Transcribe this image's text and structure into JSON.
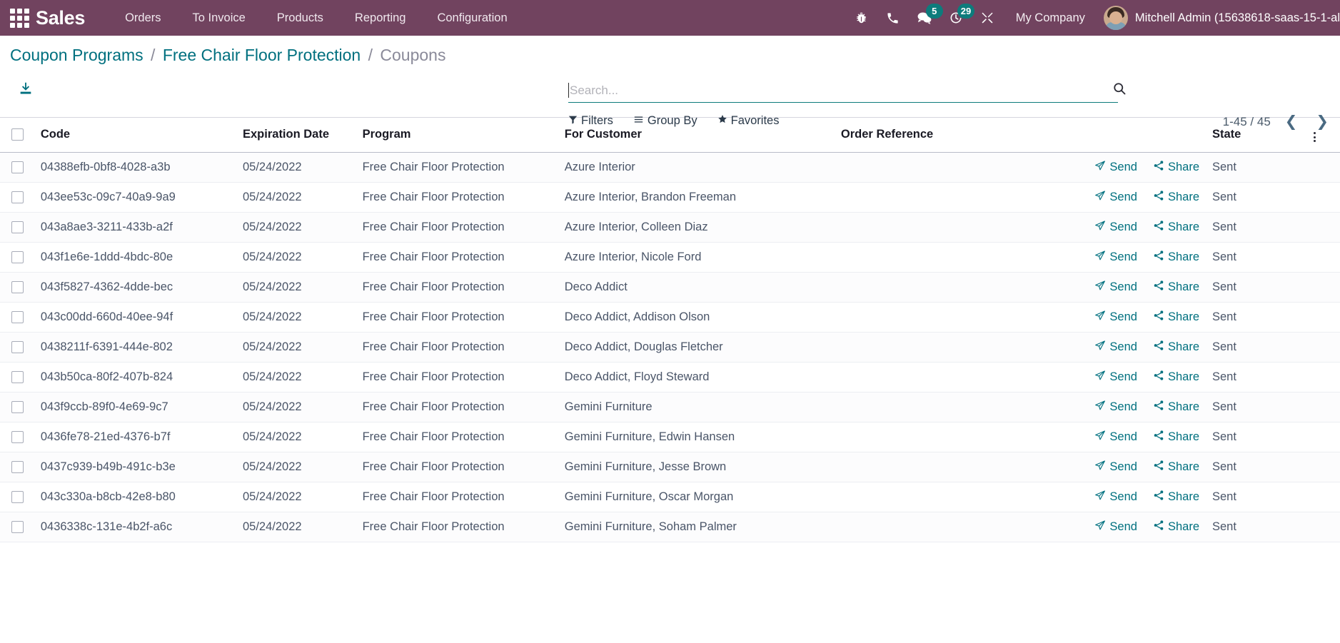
{
  "navbar": {
    "apps_icon": "apps-grid-icon",
    "brand": "Sales",
    "menu": [
      {
        "label": "Orders"
      },
      {
        "label": "To Invoice"
      },
      {
        "label": "Products"
      },
      {
        "label": "Reporting"
      },
      {
        "label": "Configuration"
      }
    ],
    "icons": [
      {
        "name": "bug-icon",
        "badge": ""
      },
      {
        "name": "phone-icon",
        "badge": ""
      },
      {
        "name": "messages-icon",
        "badge": "5"
      },
      {
        "name": "activities-clock-icon",
        "badge": "29"
      },
      {
        "name": "developer-tools-icon",
        "badge": ""
      }
    ],
    "company": "My Company",
    "user": "Mitchell Admin (15638618-saas-15-1-al",
    "bg_color": "#71435f",
    "badge_color": "#0d7c7c"
  },
  "breadcrumb": {
    "items": [
      {
        "label": "Coupon Programs",
        "current": false
      },
      {
        "label": "Free Chair Floor Protection",
        "current": false
      },
      {
        "label": "Coupons",
        "current": true
      }
    ],
    "separator": "/",
    "link_color": "#00707f"
  },
  "actions": {
    "download_icon": "download-icon"
  },
  "search": {
    "placeholder": "Search...",
    "value": "",
    "magnifier_icon": "search-icon",
    "underline_color": "#0d7c7c"
  },
  "filterbar": [
    {
      "label": "Filters",
      "icon": "filter-funnel-icon"
    },
    {
      "label": "Group By",
      "icon": "group-by-lines-icon"
    },
    {
      "label": "Favorites",
      "icon": "star-icon"
    }
  ],
  "pager": {
    "range": "1-45 / 45",
    "prev_icon": "chevron-left-icon",
    "next_icon": "chevron-right-icon"
  },
  "table": {
    "columns": [
      "Code",
      "Expiration Date",
      "Program",
      "For Customer",
      "Order Reference",
      "State"
    ],
    "row_action_labels": {
      "send": "Send",
      "share": "Share"
    },
    "row_action_icons": {
      "send": "paper-plane-icon",
      "share": "share-alt-icon"
    },
    "optional_columns_icon": "vertical-dots-icon",
    "rows": [
      {
        "code": "04388efb-0bf8-4028-a3b",
        "expiration": "05/24/2022",
        "program": "Free Chair Floor Protection",
        "customer": "Azure Interior",
        "order": "",
        "state": "Sent"
      },
      {
        "code": "043ee53c-09c7-40a9-9a9",
        "expiration": "05/24/2022",
        "program": "Free Chair Floor Protection",
        "customer": "Azure Interior, Brandon Freeman",
        "order": "",
        "state": "Sent"
      },
      {
        "code": "043a8ae3-3211-433b-a2f",
        "expiration": "05/24/2022",
        "program": "Free Chair Floor Protection",
        "customer": "Azure Interior, Colleen Diaz",
        "order": "",
        "state": "Sent"
      },
      {
        "code": "043f1e6e-1ddd-4bdc-80e",
        "expiration": "05/24/2022",
        "program": "Free Chair Floor Protection",
        "customer": "Azure Interior, Nicole Ford",
        "order": "",
        "state": "Sent"
      },
      {
        "code": "043f5827-4362-4dde-bec",
        "expiration": "05/24/2022",
        "program": "Free Chair Floor Protection",
        "customer": "Deco Addict",
        "order": "",
        "state": "Sent"
      },
      {
        "code": "043c00dd-660d-40ee-94f",
        "expiration": "05/24/2022",
        "program": "Free Chair Floor Protection",
        "customer": "Deco Addict, Addison Olson",
        "order": "",
        "state": "Sent"
      },
      {
        "code": "0438211f-6391-444e-802",
        "expiration": "05/24/2022",
        "program": "Free Chair Floor Protection",
        "customer": "Deco Addict, Douglas Fletcher",
        "order": "",
        "state": "Sent"
      },
      {
        "code": "043b50ca-80f2-407b-824",
        "expiration": "05/24/2022",
        "program": "Free Chair Floor Protection",
        "customer": "Deco Addict, Floyd Steward",
        "order": "",
        "state": "Sent"
      },
      {
        "code": "043f9ccb-89f0-4e69-9c7",
        "expiration": "05/24/2022",
        "program": "Free Chair Floor Protection",
        "customer": "Gemini Furniture",
        "order": "",
        "state": "Sent"
      },
      {
        "code": "0436fe78-21ed-4376-b7f",
        "expiration": "05/24/2022",
        "program": "Free Chair Floor Protection",
        "customer": "Gemini Furniture, Edwin Hansen",
        "order": "",
        "state": "Sent"
      },
      {
        "code": "0437c939-b49b-491c-b3e",
        "expiration": "05/24/2022",
        "program": "Free Chair Floor Protection",
        "customer": "Gemini Furniture, Jesse Brown",
        "order": "",
        "state": "Sent"
      },
      {
        "code": "043c330a-b8cb-42e8-b80",
        "expiration": "05/24/2022",
        "program": "Free Chair Floor Protection",
        "customer": "Gemini Furniture, Oscar Morgan",
        "order": "",
        "state": "Sent"
      },
      {
        "code": "0436338c-131e-4b2f-a6c",
        "expiration": "05/24/2022",
        "program": "Free Chair Floor Protection",
        "customer": "Gemini Furniture, Soham Palmer",
        "order": "",
        "state": "Sent"
      }
    ]
  }
}
